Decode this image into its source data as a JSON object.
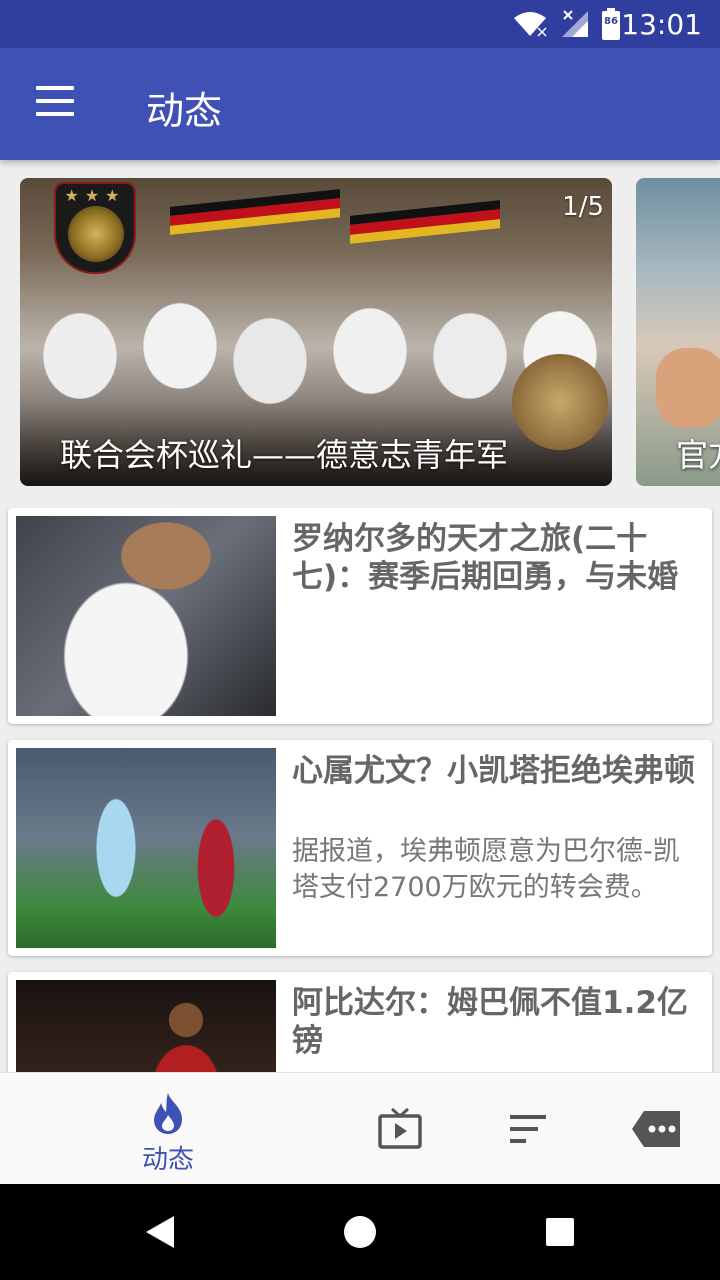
{
  "status_bar": {
    "time": "13:01",
    "battery": "86",
    "icons": [
      "wifi-icon",
      "signal-icon",
      "battery-icon"
    ]
  },
  "app_bar": {
    "title": "动态",
    "menu_icon": "menu-icon"
  },
  "banner": {
    "counter": "1/5",
    "slides": [
      {
        "caption": "联合会杯巡礼——德意志青年军"
      },
      {
        "caption": "官方"
      }
    ]
  },
  "feed": [
    {
      "title": "罗纳尔多的天才之旅(二十七)：赛季后期回勇，与未婚",
      "summary": ""
    },
    {
      "title": "心属尤文？小凯塔拒绝埃弗顿",
      "summary": "据报道，埃弗顿愿意为巴尔德-凯塔支付2700万欧元的转会费。"
    },
    {
      "title": "阿比达尔：姆巴佩不值1.2亿镑",
      "summary": ""
    }
  ],
  "bottom_nav": {
    "items": [
      {
        "label": "动态",
        "icon": "flame-icon",
        "active": true
      },
      {
        "label": "",
        "icon": "tv-icon",
        "active": false
      },
      {
        "label": "",
        "icon": "sort-icon",
        "active": false
      },
      {
        "label": "",
        "icon": "chat-tag-icon",
        "active": false
      }
    ]
  },
  "colors": {
    "primary": "#3f51b5",
    "primary_dark": "#303f9f",
    "inactive_icon": "#555555"
  }
}
